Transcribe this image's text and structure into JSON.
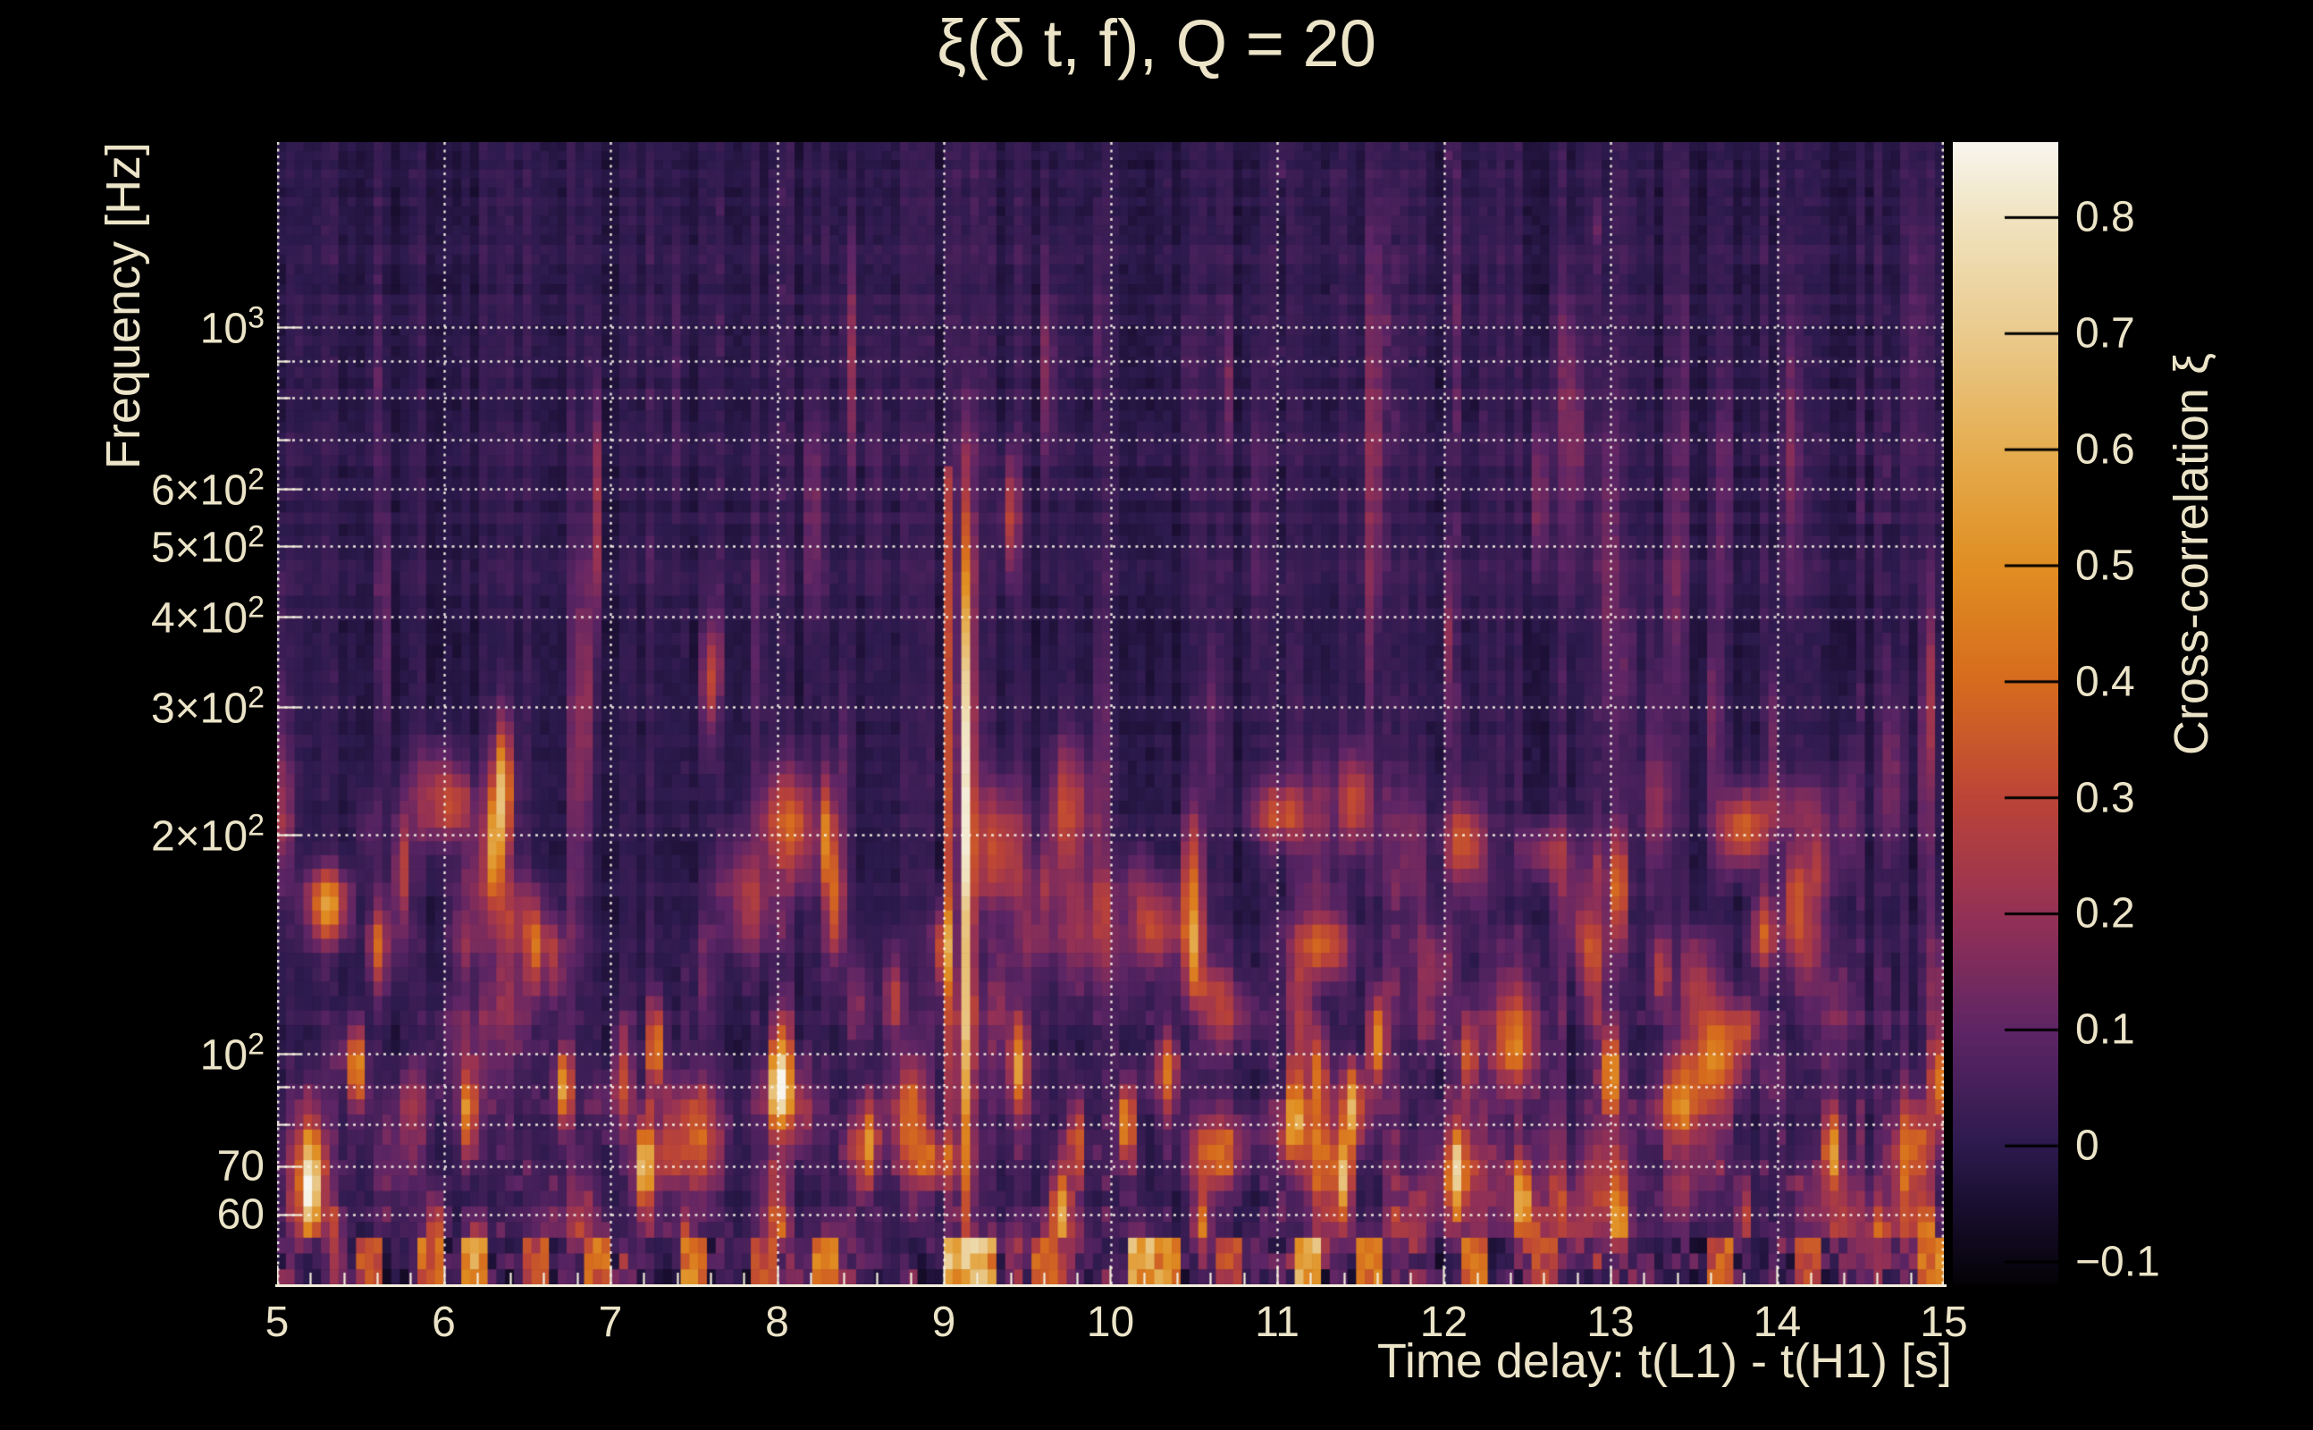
{
  "figure": {
    "background": "#000000",
    "text_color": "#ece4c8"
  },
  "chart_data": {
    "type": "heatmap",
    "title": "ξ(δ t, f), Q = 20",
    "xlabel": "Time delay: t(L1) - t(H1) [s]",
    "ylabel": "Frequency [Hz]",
    "zlabel": "Cross-correlation ξ",
    "x_range": [
      5,
      15
    ],
    "x_ticks": [
      "5",
      "6",
      "7",
      "8",
      "9",
      "10",
      "11",
      "12",
      "13",
      "14",
      "15"
    ],
    "x_tick_values": [
      5,
      6,
      7,
      8,
      9,
      10,
      11,
      12,
      13,
      14,
      15
    ],
    "x_minor_step": 0.2,
    "y_scale": "log",
    "y_range_hz": [
      48,
      1800
    ],
    "y_ticks": [
      {
        "f": 1000,
        "base": "10",
        "exp": "3"
      },
      {
        "f": 600,
        "base": "6×10",
        "exp": "2"
      },
      {
        "f": 500,
        "base": "5×10",
        "exp": "2"
      },
      {
        "f": 400,
        "base": "4×10",
        "exp": "2"
      },
      {
        "f": 300,
        "base": "3×10",
        "exp": "2"
      },
      {
        "f": 200,
        "base": "2×10",
        "exp": "2"
      },
      {
        "f": 100,
        "base": "10",
        "exp": "2"
      },
      {
        "f": 70,
        "base": "70",
        "exp": ""
      },
      {
        "f": 60,
        "base": "60",
        "exp": ""
      }
    ],
    "y_gridlines_hz": [
      60,
      70,
      80,
      90,
      100,
      200,
      300,
      400,
      500,
      600,
      700,
      800,
      900,
      1000
    ],
    "y_minor_gridlines_hz": [
      80,
      90,
      700,
      800,
      900
    ],
    "grid_style": "dotted",
    "z_range": [
      -0.12,
      0.865
    ],
    "colorbar_ticks": [
      {
        "v": 0.8,
        "label": "0.8"
      },
      {
        "v": 0.7,
        "label": "0.7"
      },
      {
        "v": 0.6,
        "label": "0.6"
      },
      {
        "v": 0.5,
        "label": "0.5"
      },
      {
        "v": 0.4,
        "label": "0.4"
      },
      {
        "v": 0.3,
        "label": "0.3"
      },
      {
        "v": 0.2,
        "label": "0.2"
      },
      {
        "v": 0.1,
        "label": "0.1"
      },
      {
        "v": 0,
        "label": "0"
      },
      {
        "v": -0.1,
        "label": "−0.1"
      }
    ],
    "colormap_stops": [
      [
        -0.12,
        "#040206"
      ],
      [
        -0.05,
        "#190e30"
      ],
      [
        0.0,
        "#2c1a4d"
      ],
      [
        0.1,
        "#5e2565"
      ],
      [
        0.2,
        "#943155"
      ],
      [
        0.3,
        "#bc4437"
      ],
      [
        0.4,
        "#d66b1e"
      ],
      [
        0.5,
        "#e08e22"
      ],
      [
        0.6,
        "#e5ad50"
      ],
      [
        0.7,
        "#eaca8d"
      ],
      [
        0.8,
        "#f0e3c0"
      ],
      [
        0.865,
        "#f8f5ee"
      ]
    ],
    "signal": {
      "main": {
        "t": 9.14,
        "sigma_t": 0.026,
        "f_peak_hz": 285,
        "sigma_logf_below": 0.42,
        "sigma_logf_above": 0.2,
        "amp": 0.63,
        "base_below": 0.15,
        "f_cut_hz": 820
      },
      "secondary": {
        "t": 9.03,
        "sigma_t": 0.018,
        "f_peak_hz": 300,
        "sigma_logf": 0.4,
        "amp": 0.3,
        "f_max_hz": 650
      }
    },
    "features": [
      [
        5.2,
        64,
        0.5
      ],
      [
        5.35,
        53,
        0.35
      ],
      [
        5.48,
        95,
        0.5
      ],
      [
        5.6,
        140,
        0.3
      ],
      [
        5.75,
        180,
        0.3
      ],
      [
        5.95,
        56,
        0.45
      ],
      [
        6.15,
        82,
        0.45
      ],
      [
        6.2,
        52,
        0.5
      ],
      [
        6.3,
        190,
        0.4
      ],
      [
        6.35,
        240,
        0.28
      ],
      [
        6.55,
        140,
        0.35
      ],
      [
        6.72,
        90,
        0.55
      ],
      [
        7.2,
        70,
        0.55
      ],
      [
        7.27,
        102,
        0.5
      ],
      [
        7.45,
        52,
        0.45
      ],
      [
        7.6,
        330,
        0.3
      ],
      [
        8.0,
        90,
        0.4
      ],
      [
        8.3,
        200,
        0.42
      ],
      [
        8.35,
        160,
        0.35
      ],
      [
        8.55,
        75,
        0.45
      ],
      [
        8.7,
        120,
        0.3
      ],
      [
        9.0,
        140,
        0.45
      ],
      [
        9.4,
        550,
        0.28
      ],
      [
        9.45,
        97,
        0.4
      ],
      [
        9.7,
        62,
        0.45
      ],
      [
        9.8,
        76,
        0.35
      ],
      [
        10.1,
        80,
        0.55
      ],
      [
        10.35,
        95,
        0.3
      ],
      [
        10.5,
        140,
        0.35
      ],
      [
        10.55,
        57,
        0.4
      ],
      [
        11.1,
        83,
        0.4
      ],
      [
        11.25,
        95,
        0.35
      ],
      [
        11.4,
        67,
        0.6
      ],
      [
        11.45,
        85,
        0.45
      ],
      [
        11.6,
        105,
        0.5
      ],
      [
        12.08,
        68,
        0.5
      ],
      [
        12.15,
        100,
        0.4
      ],
      [
        12.47,
        63,
        0.55
      ],
      [
        12.55,
        52,
        0.4
      ],
      [
        13.0,
        95,
        0.55
      ],
      [
        13.05,
        58,
        0.45
      ],
      [
        13.05,
        170,
        0.4
      ],
      [
        13.3,
        130,
        0.3
      ],
      [
        13.8,
        60,
        0.3
      ],
      [
        14.1,
        160,
        0.3
      ],
      [
        14.33,
        75,
        0.5
      ],
      [
        14.6,
        55,
        0.35
      ],
      [
        14.9,
        55,
        0.4
      ],
      [
        14.97,
        92,
        0.4
      ]
    ],
    "bottom_band_tiles": [
      [
        5.55,
        0.3
      ],
      [
        5.9,
        0.38
      ],
      [
        6.18,
        0.5
      ],
      [
        6.55,
        0.3
      ],
      [
        6.9,
        0.38
      ],
      [
        7.5,
        0.45
      ],
      [
        7.9,
        0.3
      ],
      [
        8.3,
        0.4
      ],
      [
        9.08,
        0.6
      ],
      [
        9.16,
        0.65
      ],
      [
        9.24,
        0.5
      ],
      [
        9.6,
        0.35
      ],
      [
        10.2,
        0.55
      ],
      [
        10.32,
        0.5
      ],
      [
        10.7,
        0.3
      ],
      [
        11.2,
        0.6
      ],
      [
        11.55,
        0.4
      ],
      [
        12.2,
        0.42
      ],
      [
        12.6,
        0.3
      ],
      [
        13.65,
        0.35
      ],
      [
        14.2,
        0.3
      ],
      [
        14.9,
        0.45
      ]
    ],
    "noise_seed": 1337
  }
}
